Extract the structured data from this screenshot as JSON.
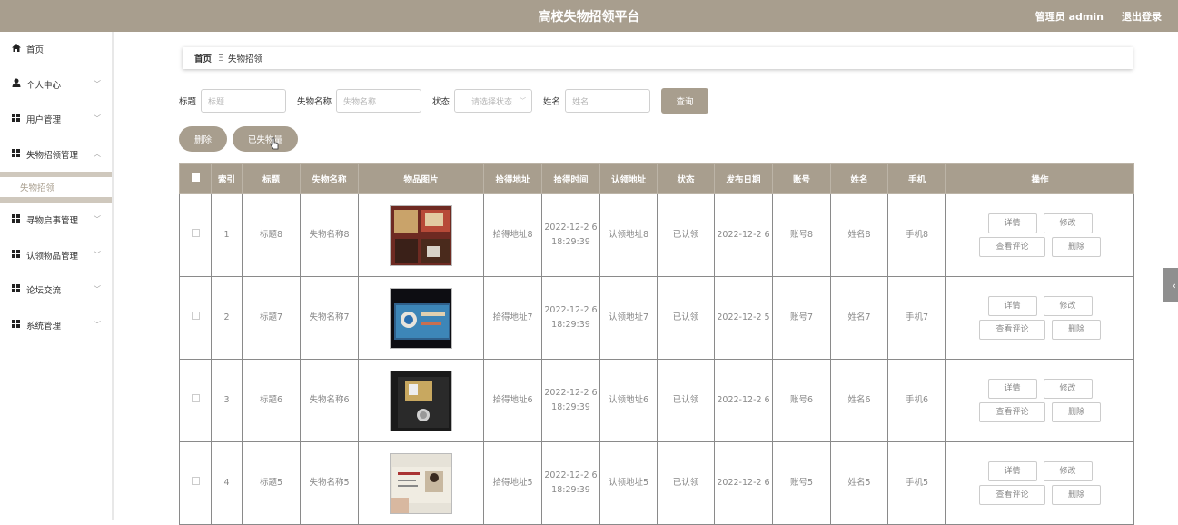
{
  "header": {
    "title": "高校失物招领平台",
    "user": "管理员 admin",
    "logout": "退出登录"
  },
  "sidebar": {
    "items": [
      {
        "label": "首页",
        "icon": "home-icon",
        "chevron": false
      },
      {
        "label": "个人中心",
        "icon": "person-icon",
        "chevron": true
      },
      {
        "label": "用户管理",
        "icon": "grid-icon",
        "chevron": true
      },
      {
        "label": "失物招领管理",
        "icon": "grid-icon",
        "chevron": true,
        "open": true
      },
      {
        "label": "寻物启事管理",
        "icon": "grid-icon",
        "chevron": true
      },
      {
        "label": "认领物品管理",
        "icon": "grid-icon",
        "chevron": true
      },
      {
        "label": "论坛交流",
        "icon": "grid-icon",
        "chevron": true
      },
      {
        "label": "系统管理",
        "icon": "grid-icon",
        "chevron": true
      }
    ],
    "subitem": "失物招领"
  },
  "breadcrumb": {
    "home": "首页",
    "sep": "Ξ",
    "current": "失物招领"
  },
  "search": {
    "title_label": "标题",
    "title_placeholder": "标题",
    "name_label": "失物名称",
    "name_placeholder": "失物名称",
    "status_label": "状态",
    "status_placeholder": "请选择状态",
    "person_label": "姓名",
    "person_placeholder": "姓名",
    "query": "查询"
  },
  "actions": {
    "delete": "删除",
    "found": "已失物量"
  },
  "table": {
    "headers": [
      "",
      "索引",
      "标题",
      "失物名称",
      "物品图片",
      "拾得地址",
      "拾得时间",
      "认领地址",
      "状态",
      "发布日期",
      "账号",
      "姓名",
      "手机",
      "操作"
    ],
    "rows": [
      {
        "index": "1",
        "title": "标题8",
        "name": "失物名称8",
        "addr": "拾得地址8",
        "time": "2022-12-2 6 18:29:39",
        "claim": "认领地址8",
        "status": "已认领",
        "date": "2022-12-2 6",
        "account": "账号8",
        "person": "姓名8",
        "phone": "手机8"
      },
      {
        "index": "2",
        "title": "标题7",
        "name": "失物名称7",
        "addr": "拾得地址7",
        "time": "2022-12-2 6 18:29:39",
        "claim": "认领地址7",
        "status": "已认领",
        "date": "2022-12-2 5",
        "account": "账号7",
        "person": "姓名7",
        "phone": "手机7"
      },
      {
        "index": "3",
        "title": "标题6",
        "name": "失物名称6",
        "addr": "拾得地址6",
        "time": "2022-12-2 6 18:29:39",
        "claim": "认领地址6",
        "status": "已认领",
        "date": "2022-12-2 6",
        "account": "账号6",
        "person": "姓名6",
        "phone": "手机6"
      },
      {
        "index": "4",
        "title": "标题5",
        "name": "失物名称5",
        "addr": "拾得地址5",
        "time": "2022-12-2 6 18:29:39",
        "claim": "认领地址5",
        "status": "已认领",
        "date": "2022-12-2 6",
        "account": "账号5",
        "person": "姓名5",
        "phone": "手机5"
      }
    ],
    "ops": {
      "detail": "详情",
      "edit": "修改",
      "comments": "查看评论",
      "del": "删除"
    }
  },
  "colors": {
    "accent": "#a89e8e"
  }
}
